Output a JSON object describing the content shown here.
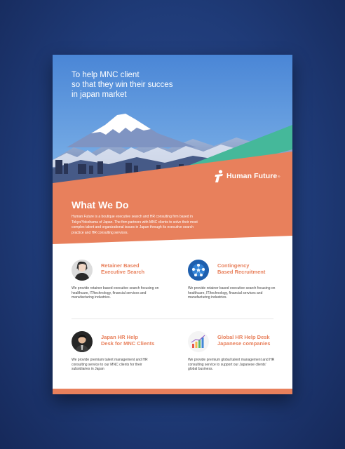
{
  "hero": {
    "tagline": "To help MNC client\nso that they win their succes\nin japan market"
  },
  "brand": {
    "name": "Human Future",
    "registered_mark": "®"
  },
  "what_we_do": {
    "title": "What We Do",
    "body": "Human Future is a boutique executive search and HR consulting firm based in Tokyo/Yokohama of Japan. The firm partners with MNC clients to solve their most complex talent and organizational issues in Japan through its executive search practice and HR consulting services."
  },
  "services": [
    {
      "title": "Retainer Based\nExecutive Search",
      "description": "We provide retainer based executive search focusing on healthcare, IT/technology, financial services and manufacturing industries.",
      "icon": "headset-woman-icon"
    },
    {
      "title": "Contingency\nBased Recruitment",
      "description": "We provide retainer based executive search focusing on healthcare, IT/technology, financial services and manufacturing industries.",
      "icon": "network-globe-icon"
    },
    {
      "title": "Japan HR Help\nDesk for MNC Clients",
      "description": "We provide premium talent management and HR consulting service to our MNC clients for their subsidiaries in Japan",
      "icon": "businessman-icon"
    },
    {
      "title": "Global HR Help Desk\nJapanese companies",
      "description": "We provide premium global talent management and HR consulting service to support our Japanese clients' global business.",
      "icon": "business-chart-icon"
    }
  ],
  "colors": {
    "accent": "#e8805c",
    "teal": "#45b89a",
    "sky": "#4f8fd8",
    "background": "#1f3b78"
  }
}
